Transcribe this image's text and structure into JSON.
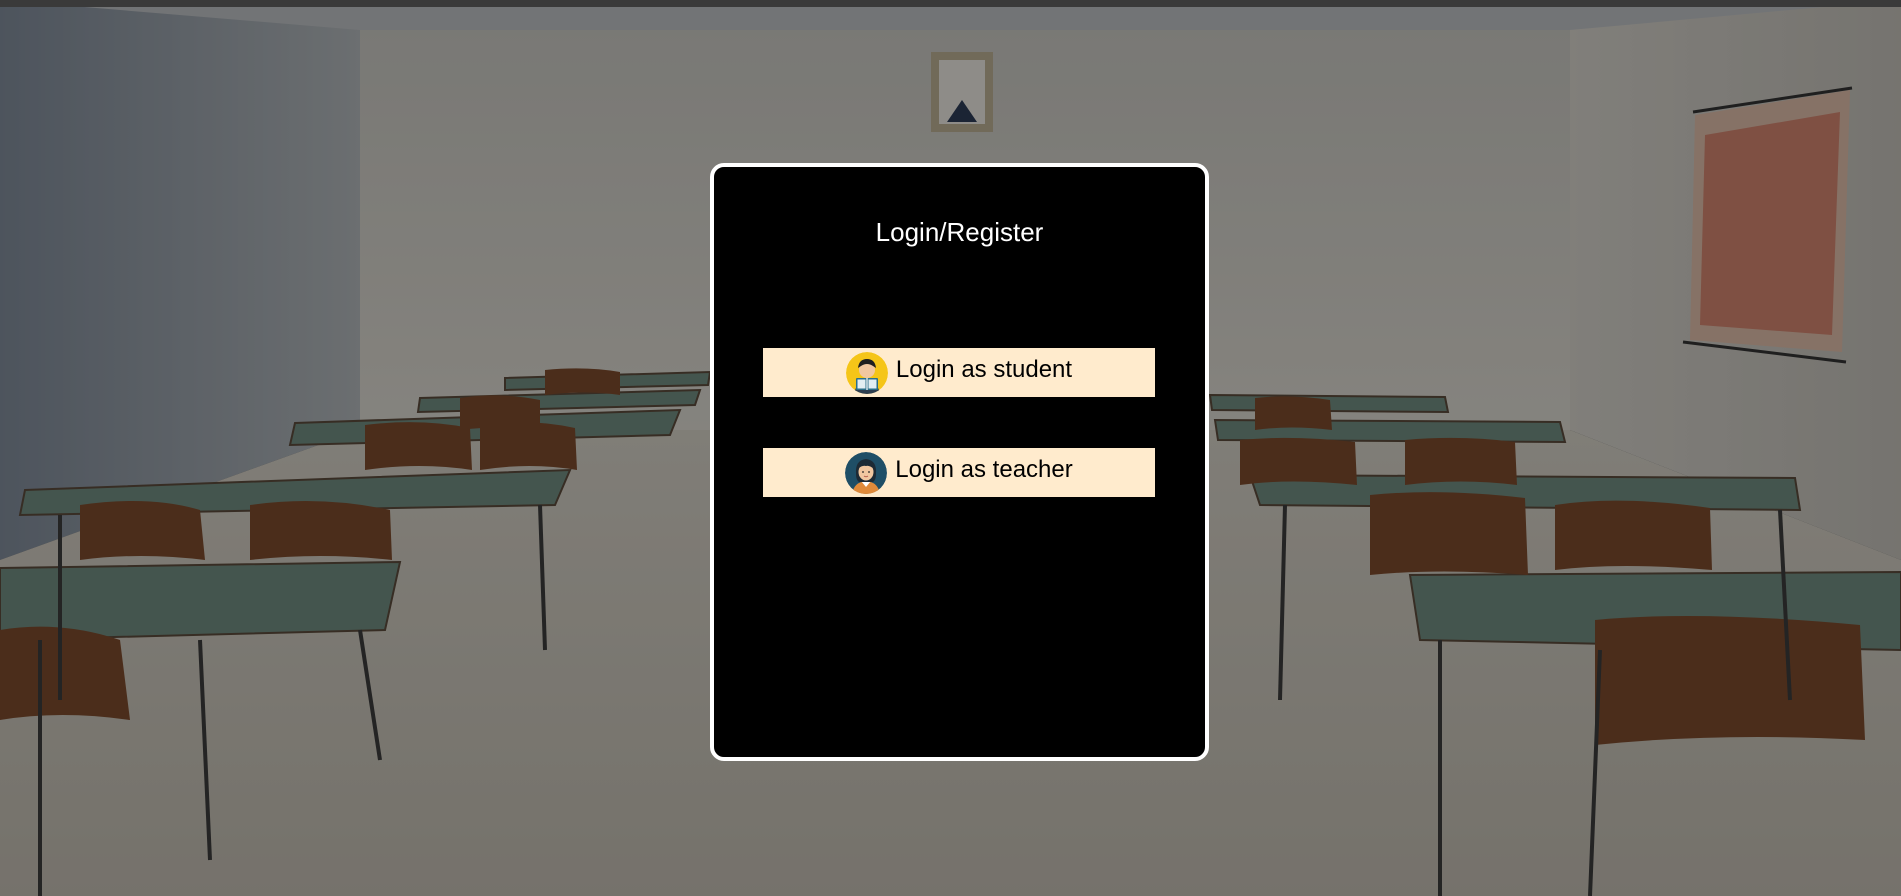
{
  "modal": {
    "title": "Login/Register",
    "buttons": [
      {
        "label": "Login as student",
        "icon": "student-avatar-icon",
        "icon_bg": "#f5c518"
      },
      {
        "label": "Login as teacher",
        "icon": "teacher-avatar-icon",
        "icon_bg": "#1f4e66"
      }
    ]
  },
  "colors": {
    "modal_background": "#000000",
    "modal_border": "#ffffff",
    "button_background": "#ffebcd",
    "title_text": "#ffffff",
    "button_text": "#000000"
  },
  "background": {
    "description_icon": "classroom-background-image"
  }
}
